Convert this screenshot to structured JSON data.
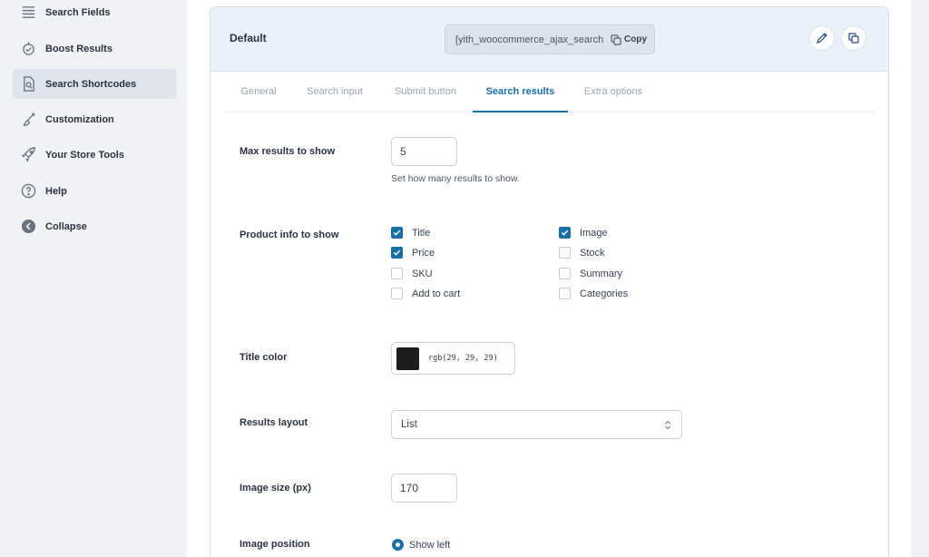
{
  "sidebar": {
    "items": [
      {
        "label": "Search Fields",
        "icon": "list-icon"
      },
      {
        "label": "Boost Results",
        "icon": "boost-icon"
      },
      {
        "label": "Search Shortcodes",
        "icon": "document-search-icon"
      },
      {
        "label": "Customization",
        "icon": "brush-icon"
      },
      {
        "label": "Your Store Tools",
        "icon": "rocket-icon"
      },
      {
        "label": "Help",
        "icon": "help-icon"
      },
      {
        "label": "Collapse",
        "icon": "collapse-icon"
      }
    ],
    "active_index": 2
  },
  "card": {
    "title": "Default",
    "shortcode": "[yith_woocommerce_ajax_search preset=\"default\"]",
    "copy_label": "Copy"
  },
  "tabs": [
    "General",
    "Search input",
    "Submit button",
    "Search results",
    "Extra options"
  ],
  "active_tab": 3,
  "fields": {
    "max_results": {
      "label": "Max results to show",
      "value": "5",
      "hint": "Set how many results to show."
    },
    "product_info": {
      "label": "Product info to show",
      "options": [
        {
          "label": "Title",
          "checked": true
        },
        {
          "label": "Image",
          "checked": true
        },
        {
          "label": "Price",
          "checked": true
        },
        {
          "label": "Stock",
          "checked": false
        },
        {
          "label": "SKU",
          "checked": false
        },
        {
          "label": "Summary",
          "checked": false
        },
        {
          "label": "Add to cart",
          "checked": false
        },
        {
          "label": "Categories",
          "checked": false
        }
      ]
    },
    "title_color": {
      "label": "Title color",
      "value": "rgb(29, 29, 29)",
      "swatch": "#1d1d1d"
    },
    "results_layout": {
      "label": "Results layout",
      "value": "List"
    },
    "image_size": {
      "label": "Image size (px)",
      "value": "170"
    },
    "image_position": {
      "label": "Image position",
      "value": "Show left"
    }
  },
  "colors": {
    "accent": "#1a6fa3",
    "header_bg": "#eaf1fb"
  }
}
